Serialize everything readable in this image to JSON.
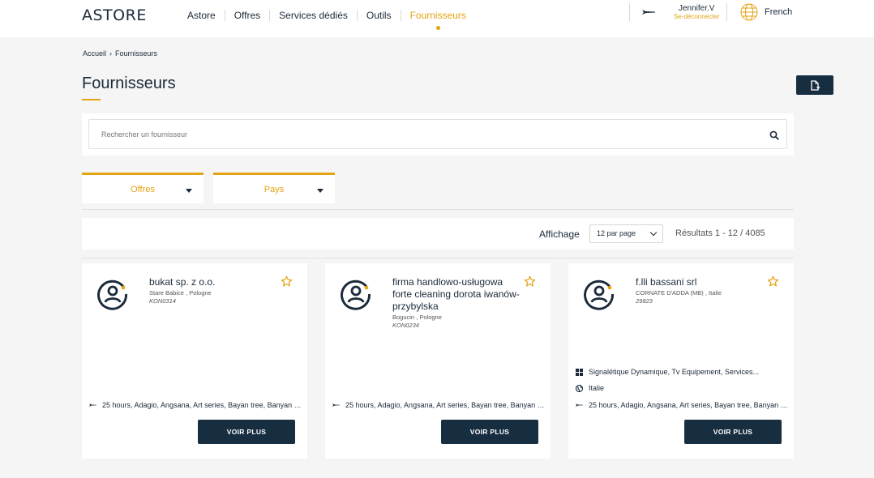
{
  "header": {
    "logo": "ASTORE",
    "nav": [
      "Astore",
      "Offres",
      "Services dédiés",
      "Outils",
      "Fournisseurs"
    ],
    "active_nav": "Fournisseurs",
    "user_name": "Jennifer.V",
    "logout_label": "Se-déconnecter",
    "language": "French"
  },
  "breadcrumb": {
    "home": "Accueil",
    "separator": "›",
    "current": "Fournisseurs"
  },
  "page": {
    "title": "Fournisseurs",
    "export_icon": "file-export-icon"
  },
  "search": {
    "placeholder": "Rechercher un fournisseur"
  },
  "filters": [
    {
      "label": "Offres"
    },
    {
      "label": "Pays"
    }
  ],
  "results_bar": {
    "affichage_label": "Affichage",
    "per_page": "12 par page",
    "results_text": "Résultats 1 - 12 / 4085"
  },
  "cards": [
    {
      "name": "bukat sp. z o.o.",
      "location": "Stare Babice , Pologne",
      "code": "KON0314",
      "hotels": "25 hours, Adagio, Angsana, Art series, Bayan tree, Banyan Tree...",
      "button": "VOIR PLUS"
    },
    {
      "name": "firma handlowo-usługowa forte cleaning dorota iwanów-przybylska",
      "location": "Bogucin , Pologne",
      "code": "KON0234",
      "hotels": "25 hours, Adagio, Angsana, Art series, Bayan tree, Banyan Tree...",
      "button": "VOIR PLUS"
    },
    {
      "name": "f.lli bassani srl",
      "location": "CORNATE D'ADDA (MB) , Italie",
      "code": "29823",
      "offers": "Signalétique Dynamique, Tv Equipement, Services...",
      "country": "Italie",
      "hotels": "25 hours, Adagio, Angsana, Art series, Bayan tree, Banyan Tree...",
      "button": "VOIR PLUS"
    }
  ],
  "colors": {
    "accent": "#e3a313",
    "navy": "#172d40",
    "background": "#f5f5f5"
  }
}
